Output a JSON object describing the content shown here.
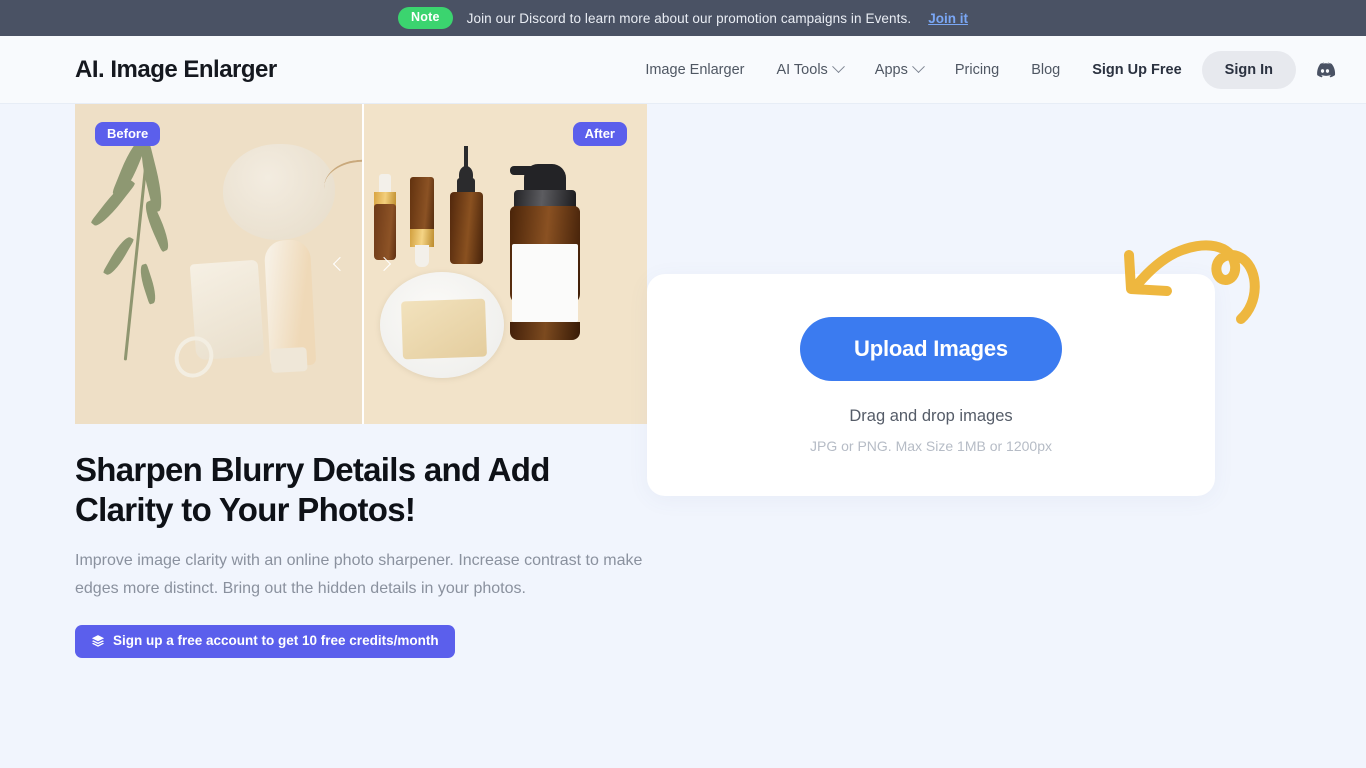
{
  "banner": {
    "badge": "Note",
    "message": "Join our Discord to learn more about our promotion campaigns in Events.",
    "link_label": "Join it",
    "background": "#4a5264",
    "badge_color": "#3bd46f",
    "link_color": "#7aa7f5"
  },
  "header": {
    "brand": "AI. Image Enlarger",
    "nav": [
      {
        "label": "Image Enlarger",
        "has_dropdown": false
      },
      {
        "label": "AI Tools",
        "has_dropdown": true
      },
      {
        "label": "Apps",
        "has_dropdown": true
      },
      {
        "label": "Pricing",
        "has_dropdown": false
      },
      {
        "label": "Blog",
        "has_dropdown": false
      }
    ],
    "sign_up_label": "Sign Up Free",
    "sign_in_label": "Sign In",
    "discord_icon": "discord-icon"
  },
  "preview": {
    "before_label": "Before",
    "after_label": "After",
    "badge_color": "#5b5fec",
    "slider_position_percent": 50
  },
  "hero": {
    "title": "Sharpen Blurry Details and Add Clarity to Your Photos!",
    "description": "Improve image clarity with an online photo sharpener. Increase contrast to make edges more distinct. Bring out the hidden details in your photos.",
    "cta_label": "Sign up a free account to get 10 free credits/month",
    "cta_icon": "layers-icon",
    "cta_color": "#5b5fec"
  },
  "upload": {
    "button_label": "Upload Images",
    "button_color": "#3b7bf0",
    "drag_text": "Drag and drop images",
    "limit_text": "JPG or PNG. Max Size 1MB or 1200px",
    "arrow_icon": "curved-arrow-icon",
    "arrow_color": "#eeb73f"
  },
  "theme": {
    "page_background": "#f1f5fd",
    "header_background": "#f8fafd",
    "card_background": "#ffffff"
  }
}
